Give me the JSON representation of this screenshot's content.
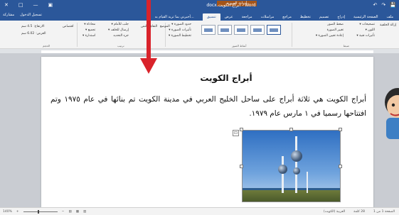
{
  "titlebar": {
    "doc_title": "Word - أبراج الكويت.docx",
    "context_tab": "أدوات الصورة",
    "qat": [
      "↶",
      "↷",
      "💾"
    ],
    "win_ctrl": [
      "✕",
      "□",
      "—",
      "▣"
    ]
  },
  "tabs": {
    "items": [
      "ملف",
      "الصفحة الرئيسية",
      "إدراج",
      "تصميم",
      "تخطيط",
      "مراجع",
      "مراسلات",
      "مراجعة",
      "عرض",
      "تنسيق"
    ],
    "tell_me": "أخبرني بما تريد القيام به...",
    "share": [
      "مشاركة",
      "تسجيل الدخول"
    ]
  },
  "ribbon": {
    "group_labels": [
      "ضبط",
      "أنماط الصور",
      "ترتيب",
      "الحجم"
    ],
    "adjust_items": [
      "تصحيحات ▾",
      "اللون ▾",
      "تأثيرات فنية ▾"
    ],
    "adjust_items2": [
      "ضغط الصور",
      "تغيير الصورة",
      "إعادة تعيين الصورة ▾"
    ],
    "remove_bg": "إزالة الخلفية",
    "style_items": [
      "حدود الصورة ▾",
      "تأثيرات الصورة ▾",
      "تخطيط الصورة ▾"
    ],
    "arrange_items": [
      "جلب للأمام ▾",
      "إرسال للخلف ▾",
      "جزء التحديد"
    ],
    "arrange_items2": [
      "محاذاة ▾",
      "تجميع ▾",
      "استدارة ▾"
    ],
    "position_label": "الموضع",
    "wrap_label": "التفاف النص",
    "crop_label": "اقتصاص",
    "height_label": "الارتفاع:",
    "height_value": "4.5 سم",
    "width_label": "العرض:",
    "width_value": "6.02 سم"
  },
  "document": {
    "heading": "أبراج الكويت",
    "paragraph": "أبراج الكويت هي ثلاثة أبراج على ساحل الخليج العربي في مدينة الكويت تم بنائها في عام ١٩٧٥ وتم افتتاحها رسميا في ١ مارس عام ١٩٧٩."
  },
  "statusbar": {
    "page": "الصفحة 1 من 1",
    "words": "28 كلمة",
    "language": "العربية (الكويت)",
    "zoom": "140%",
    "view_icons": [
      "▤",
      "▦",
      "▥"
    ]
  }
}
